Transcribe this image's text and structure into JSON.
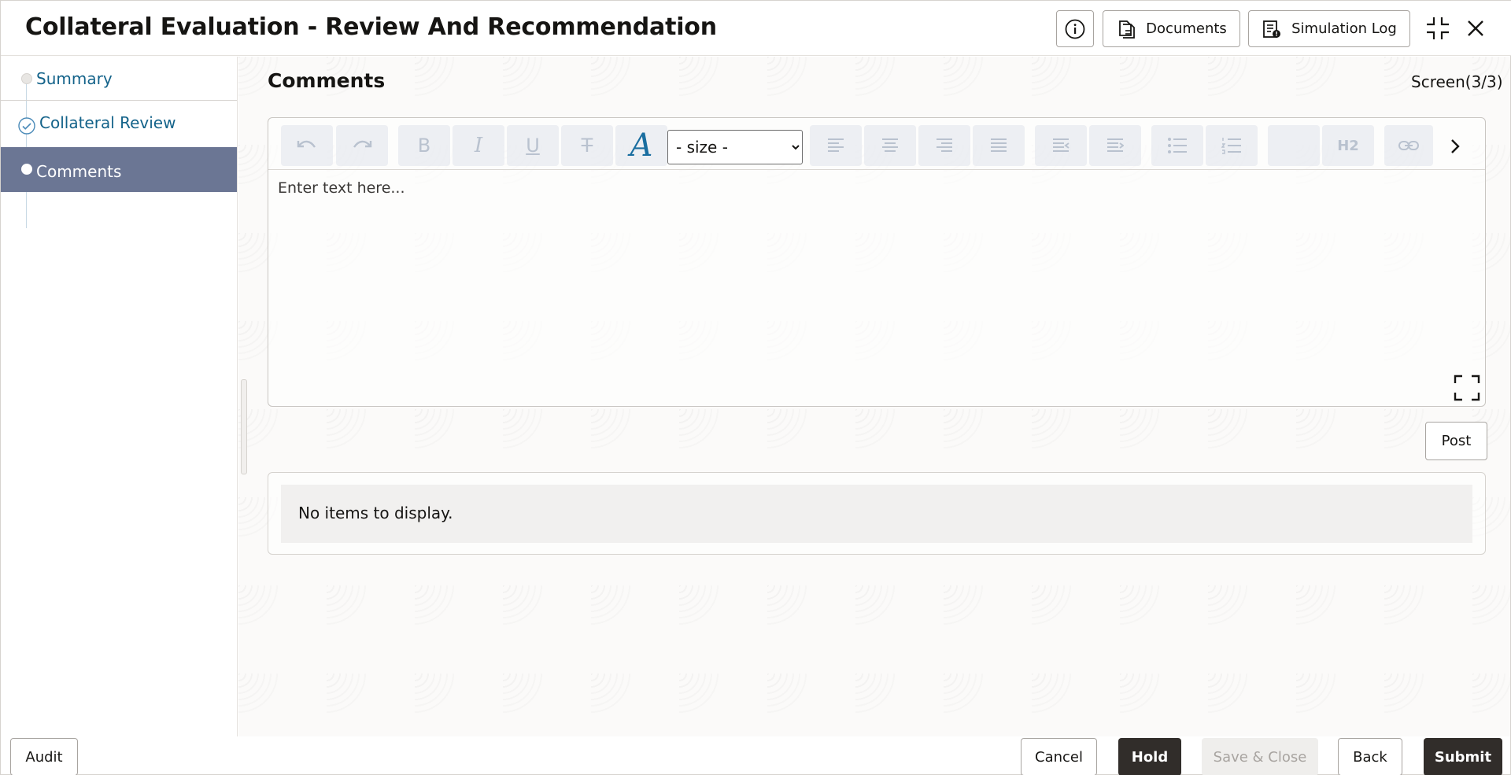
{
  "header": {
    "title": "Collateral Evaluation - Review And Recommendation",
    "info_icon": "info-icon",
    "documents_label": "Documents",
    "simulation_log_label": "Simulation Log"
  },
  "sidebar": {
    "steps": [
      {
        "label": "Summary",
        "state": "pending"
      },
      {
        "label": "Collateral Review",
        "state": "completed"
      },
      {
        "label": "Comments",
        "state": "active"
      }
    ]
  },
  "main": {
    "section_title": "Comments",
    "screen_count": "Screen(3/3)",
    "editor": {
      "size_select_value": "- size -",
      "placeholder": "Enter text here...",
      "heading_button": "H2"
    },
    "post_label": "Post",
    "empty_message": "No items to display."
  },
  "footer": {
    "audit": "Audit",
    "cancel": "Cancel",
    "hold": "Hold",
    "save_close": "Save & Close",
    "back": "Back",
    "submit": "Submit"
  },
  "colors": {
    "active_step": "#6b7694",
    "link": "#14638a",
    "primary_button": "#312d2a"
  }
}
